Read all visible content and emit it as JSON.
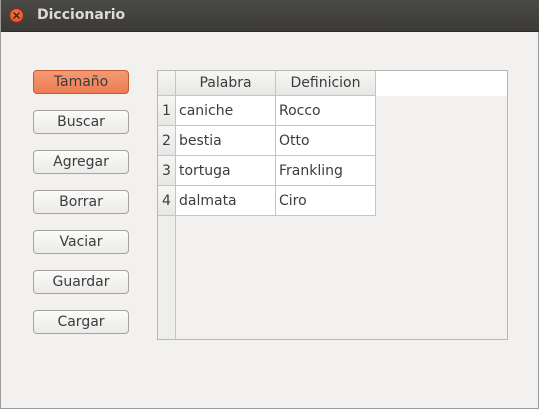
{
  "window": {
    "title": "Diccionario"
  },
  "buttons": [
    {
      "label": "Tamaño",
      "active": true
    },
    {
      "label": "Buscar"
    },
    {
      "label": "Agregar"
    },
    {
      "label": "Borrar"
    },
    {
      "label": "Vaciar"
    },
    {
      "label": "Guardar"
    },
    {
      "label": "Cargar"
    }
  ],
  "table": {
    "columns": [
      "Palabra",
      "Definicion"
    ],
    "rows": [
      {
        "num": "1",
        "cells": [
          "caniche",
          "Rocco"
        ]
      },
      {
        "num": "2",
        "cells": [
          "bestia",
          "Otto"
        ]
      },
      {
        "num": "3",
        "cells": [
          "tortuga",
          "Frankling"
        ]
      },
      {
        "num": "4",
        "cells": [
          "dalmata",
          "Ciro"
        ]
      }
    ]
  },
  "colors": {
    "accent": "#ef8558",
    "titlebar": "#3c3b37",
    "close": "#e25a2c"
  },
  "icons": {
    "close": "close-icon"
  }
}
